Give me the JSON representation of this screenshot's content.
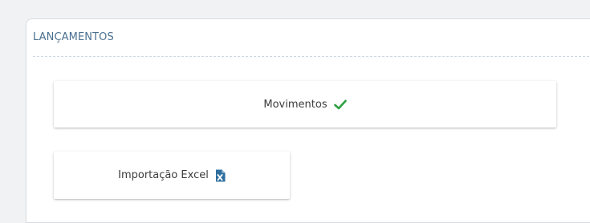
{
  "panel": {
    "title": "LANÇAMENTOS"
  },
  "actions": [
    {
      "label": "Movimentos",
      "icon": "check-icon",
      "icon_color": "#2ea043"
    },
    {
      "label": "Importação Excel",
      "icon": "excel-file-icon",
      "icon_color": "#2f6f9f"
    }
  ]
}
